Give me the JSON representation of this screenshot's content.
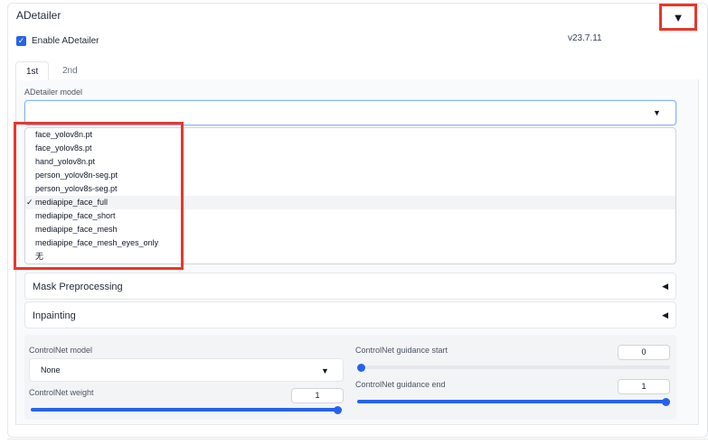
{
  "panel": {
    "title": "ADetailer",
    "collapse_icon": "▼",
    "enable_label": "Enable ADetailer",
    "enable_checked": true,
    "version": "v23.7.11"
  },
  "tabs": [
    {
      "label": "1st",
      "active": true
    },
    {
      "label": "2nd",
      "active": false
    }
  ],
  "model": {
    "label": "ADetailer model",
    "value": "",
    "options": [
      "face_yolov8n.pt",
      "face_yolov8s.pt",
      "hand_yolov8n.pt",
      "person_yolov8n-seg.pt",
      "person_yolov8s-seg.pt",
      "mediapipe_face_full",
      "mediapipe_face_short",
      "mediapipe_face_mesh",
      "mediapipe_face_mesh_eyes_only",
      "无"
    ],
    "selected_option": "mediapipe_face_full",
    "check_mark": "✓",
    "dropdown_icon": "caret-down-icon"
  },
  "accordions": [
    {
      "label": "Mask Preprocessing",
      "arrow": "◀"
    },
    {
      "label": "Inpainting",
      "arrow": "◀"
    }
  ],
  "controlnet": {
    "model_label": "ControlNet model",
    "model_value": "None",
    "weight_label": "ControlNet weight",
    "weight_value": "1",
    "weight_fraction": 1.0,
    "guidance_start_label": "ControlNet guidance start",
    "guidance_start_value": "0",
    "guidance_start_fraction": 0.0,
    "guidance_end_label": "ControlNet guidance end",
    "guidance_end_value": "1",
    "guidance_end_fraction": 1.0
  },
  "colors": {
    "accent": "#2563eb",
    "highlight_box": "#e8372b"
  }
}
